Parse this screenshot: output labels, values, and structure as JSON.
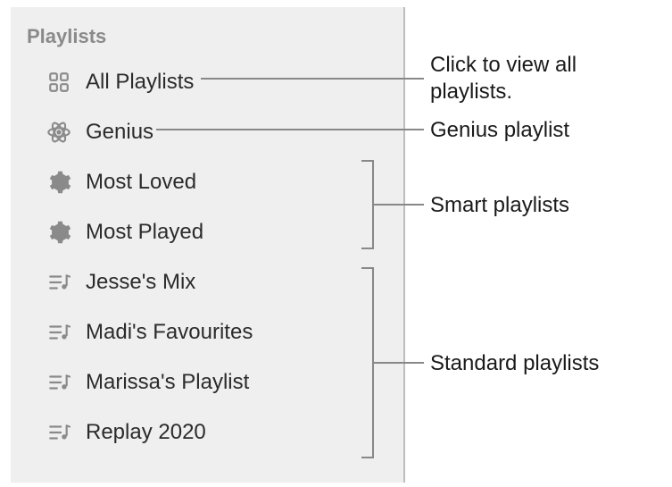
{
  "sidebar": {
    "header": "Playlists",
    "items": [
      {
        "label": "All Playlists"
      },
      {
        "label": "Genius"
      },
      {
        "label": "Most Loved"
      },
      {
        "label": "Most Played"
      },
      {
        "label": "Jesse's Mix"
      },
      {
        "label": "Madi's Favourites"
      },
      {
        "label": "Marissa's Playlist"
      },
      {
        "label": "Replay 2020"
      }
    ]
  },
  "callouts": {
    "all": "Click to view all playlists.",
    "genius": "Genius playlist",
    "smart": "Smart playlists",
    "standard": "Standard playlists"
  }
}
